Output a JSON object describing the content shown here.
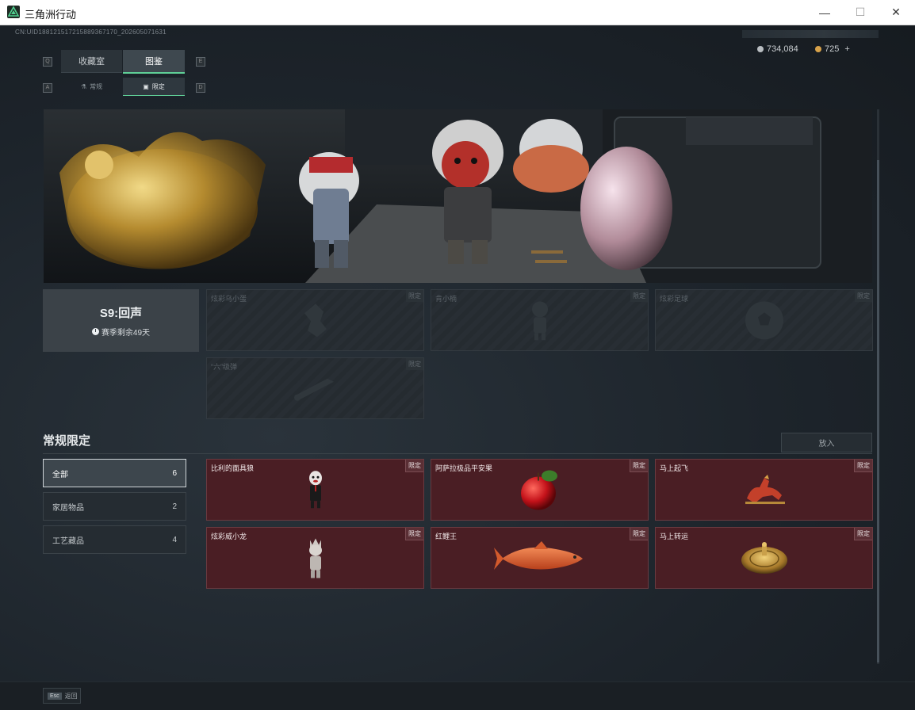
{
  "window": {
    "title": "三角洲行动",
    "minimize": "—",
    "maximize": "☐",
    "close": "✕"
  },
  "header": {
    "uid": "CN:UID18812151721588936717​0_202605071631",
    "currency_silver": "734,084",
    "currency_gold": "725",
    "plus": "+"
  },
  "tabs": [
    {
      "label": "收藏室"
    },
    {
      "label": "图鉴"
    }
  ],
  "subtabs": [
    {
      "label": "常规"
    },
    {
      "label": "限定"
    }
  ],
  "keyhints": {
    "q": "Q",
    "e": "E",
    "a": "A",
    "d": "D"
  },
  "season": {
    "title": "S9:回声",
    "remaining": "赛季剩余49天"
  },
  "season_items": [
    {
      "name": "炫彩乌小蛋",
      "badge": "限定"
    },
    {
      "name": "肯小楠",
      "badge": "限定"
    },
    {
      "name": "炫彩足球",
      "badge": "限定"
    },
    {
      "name": "“六”级弹",
      "badge": "限定"
    }
  ],
  "section": {
    "title": "常规限定",
    "place_button": "放入"
  },
  "categories": [
    {
      "label": "全部",
      "count": "6"
    },
    {
      "label": "家居物品",
      "count": "2"
    },
    {
      "label": "工艺藏品",
      "count": "4"
    }
  ],
  "regular_items": [
    {
      "name": "比利的面具狼",
      "badge": "限定",
      "icon": "puppet-figure-icon"
    },
    {
      "name": "阿萨拉极品平安果",
      "badge": "限定",
      "icon": "apple-icon"
    },
    {
      "name": "马上起飞",
      "badge": "限定",
      "icon": "horse-icon"
    },
    {
      "name": "炫彩威小龙",
      "badge": "限定",
      "icon": "doll-figure-icon"
    },
    {
      "name": "红鲤王",
      "badge": "限定",
      "icon": "carp-fish-icon"
    },
    {
      "name": "马上转运",
      "badge": "限定",
      "icon": "golden-disc-icon"
    }
  ],
  "footer": {
    "esc_key": "Esc",
    "back_label": "返回"
  },
  "colors": {
    "accent": "#5fcf97",
    "owned_bg": "#4a1e24",
    "locked_bg": "#252b30"
  }
}
